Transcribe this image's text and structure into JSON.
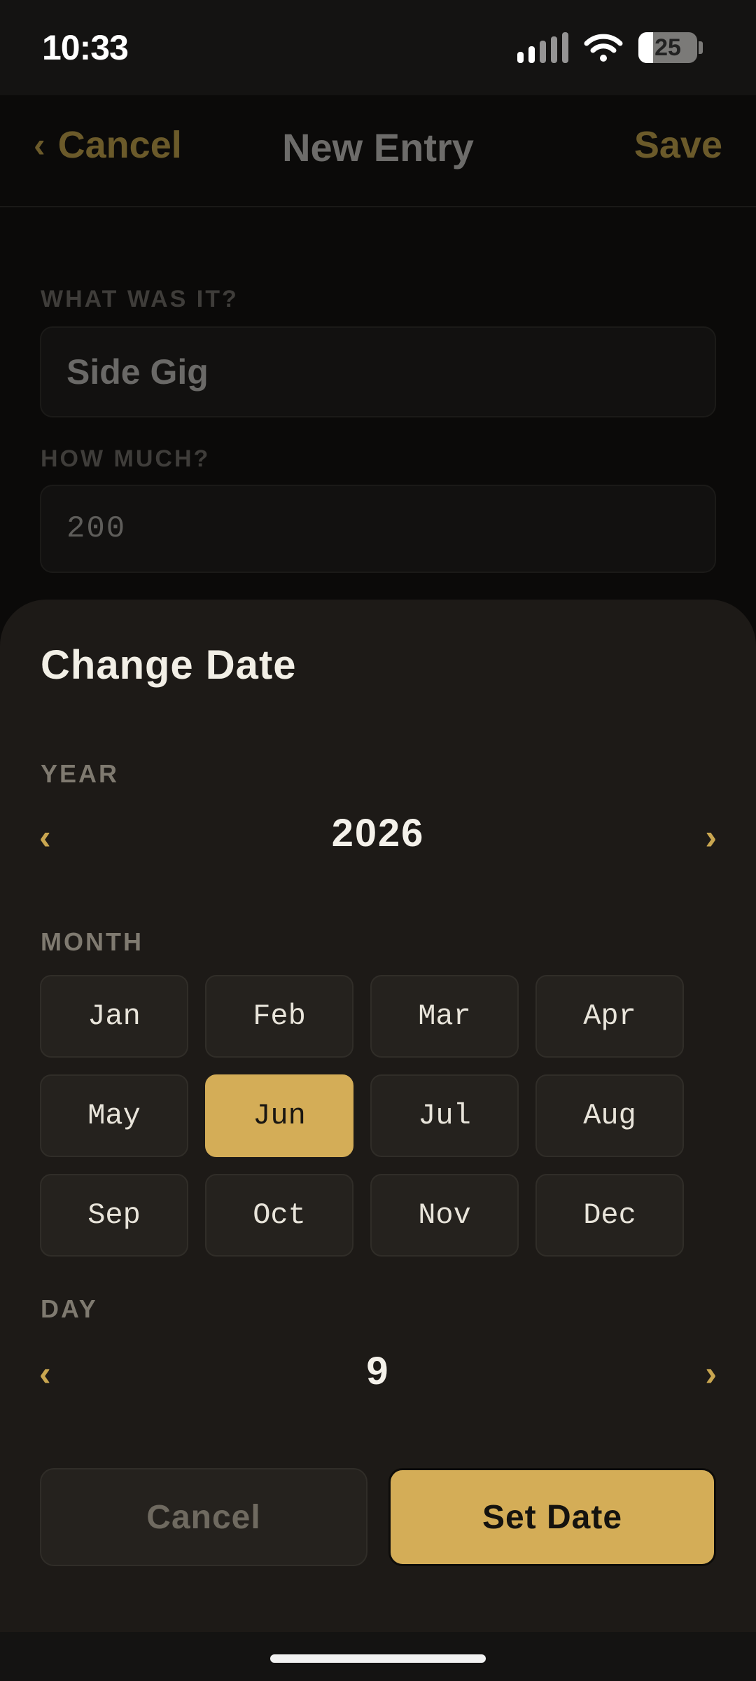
{
  "status_bar": {
    "time": "10:33",
    "battery_level": "25",
    "battery_fraction": 0.25,
    "icons": [
      "signal-icon",
      "wifi-icon",
      "battery-icon"
    ]
  },
  "nav": {
    "cancel_label": "Cancel",
    "title": "New Entry",
    "save_label": "Save",
    "back_icon": "chevron-left-icon"
  },
  "form": {
    "name_label": "WHAT WAS IT?",
    "name_value": "Side Gig",
    "amount_label": "HOW MUCH?",
    "amount_value": "200"
  },
  "date_sheet": {
    "title": "Change Date",
    "year_label": "YEAR",
    "year_value": "2026",
    "month_label": "MONTH",
    "months": [
      "Jan",
      "Feb",
      "Mar",
      "Apr",
      "May",
      "Jun",
      "Jul",
      "Aug",
      "Sep",
      "Oct",
      "Nov",
      "Dec"
    ],
    "selected_month": "Jun",
    "day_label": "DAY",
    "day_value": "9",
    "prev_glyph": "‹",
    "next_glyph": "›",
    "cancel_label": "Cancel",
    "confirm_label": "Set Date"
  },
  "colors": {
    "accent": "#d4ad57",
    "sheet_bg": "#1d1a17",
    "page_bg": "#0b0a09"
  }
}
